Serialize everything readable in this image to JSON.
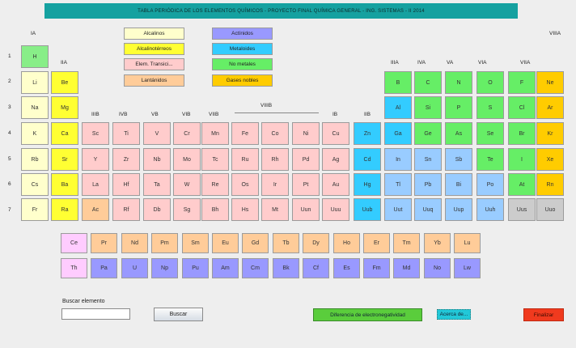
{
  "title": "TABLA PERIÓDICA DE LOS ELEMENTOS QUÍMICOS - PROYECTO FINAL QUÍMICA GENERAL - ING. SISTEMAS - II 2014",
  "colors": {
    "alcalinos": "#ffffcc",
    "alcalinoterreos": "#ffff33",
    "transicion": "#ffcccc",
    "lantanidos": "#ffcc99",
    "actinidos": "#9999ff",
    "metaloides": "#33ccff",
    "no_metales": "#66ee66",
    "gases_nobles": "#ffcc00",
    "hidrogeno": "#88ee88",
    "metales": "#99ccff",
    "desconocido": "#cccccc",
    "lantano_row": "#ffccff"
  },
  "legend": [
    {
      "label": "Alcalinos",
      "cat": "alcalinos"
    },
    {
      "label": "Alcalinotérreos",
      "cat": "alcalinoterreos"
    },
    {
      "label": "Elem. Transici...",
      "cat": "transicion"
    },
    {
      "label": "Lantánidos",
      "cat": "lantanidos"
    },
    {
      "label": "Actínidos",
      "cat": "actinidos"
    },
    {
      "label": "Metaloides",
      "cat": "metaloides"
    },
    {
      "label": "No metales",
      "cat": "no_metales"
    },
    {
      "label": "Gases nobles",
      "cat": "gases_nobles"
    }
  ],
  "group_labels": [
    "IA",
    "IIA",
    "IIIB",
    "IVB",
    "VB",
    "VIB",
    "VIIB",
    "VIIIB",
    "IB",
    "IIB",
    "IIIA",
    "IVA",
    "VA",
    "VIA",
    "VIIA",
    "VIIIA"
  ],
  "period_labels": [
    "1",
    "2",
    "3",
    "4",
    "5",
    "6",
    "7"
  ],
  "periods": [
    [
      [
        "H",
        "hidrogeno",
        1
      ]
    ],
    [
      [
        "Li",
        "alcalinos",
        1
      ],
      [
        "Be",
        "alcalinoterreos",
        2
      ],
      [
        "B",
        "no_metales",
        13
      ],
      [
        "C",
        "no_metales",
        14
      ],
      [
        "N",
        "no_metales",
        15
      ],
      [
        "O",
        "no_metales",
        16
      ],
      [
        "F",
        "no_metales",
        17
      ],
      [
        "Ne",
        "gases_nobles",
        18
      ]
    ],
    [
      [
        "Na",
        "alcalinos",
        1
      ],
      [
        "Mg",
        "alcalinoterreos",
        2
      ],
      [
        "Al",
        "metaloides",
        13
      ],
      [
        "Si",
        "no_metales",
        14
      ],
      [
        "P",
        "no_metales",
        15
      ],
      [
        "S",
        "no_metales",
        16
      ],
      [
        "Cl",
        "no_metales",
        17
      ],
      [
        "Ar",
        "gases_nobles",
        18
      ]
    ],
    [
      [
        "K",
        "alcalinos",
        1
      ],
      [
        "Ca",
        "alcalinoterreos",
        2
      ],
      [
        "Sc",
        "transicion",
        3
      ],
      [
        "Ti",
        "transicion",
        4
      ],
      [
        "V",
        "transicion",
        5
      ],
      [
        "Cr",
        "transicion",
        6
      ],
      [
        "Mn",
        "transicion",
        7
      ],
      [
        "Fe",
        "transicion",
        8
      ],
      [
        "Co",
        "transicion",
        9
      ],
      [
        "Ni",
        "transicion",
        10
      ],
      [
        "Cu",
        "transicion",
        11
      ],
      [
        "Zn",
        "metaloides",
        12
      ],
      [
        "Ga",
        "metaloides",
        13
      ],
      [
        "Ge",
        "no_metales",
        14
      ],
      [
        "As",
        "no_metales",
        15
      ],
      [
        "Se",
        "no_metales",
        16
      ],
      [
        "Br",
        "no_metales",
        17
      ],
      [
        "Kr",
        "gases_nobles",
        18
      ]
    ],
    [
      [
        "Rb",
        "alcalinos",
        1
      ],
      [
        "Sr",
        "alcalinoterreos",
        2
      ],
      [
        "Y",
        "transicion",
        3
      ],
      [
        "Zr",
        "transicion",
        4
      ],
      [
        "Nb",
        "transicion",
        5
      ],
      [
        "Mo",
        "transicion",
        6
      ],
      [
        "Tc",
        "transicion",
        7
      ],
      [
        "Ru",
        "transicion",
        8
      ],
      [
        "Rh",
        "transicion",
        9
      ],
      [
        "Pd",
        "transicion",
        10
      ],
      [
        "Ag",
        "transicion",
        11
      ],
      [
        "Cd",
        "metaloides",
        12
      ],
      [
        "In",
        "metales",
        13
      ],
      [
        "Sn",
        "metales",
        14
      ],
      [
        "Sb",
        "metales",
        15
      ],
      [
        "Te",
        "no_metales",
        16
      ],
      [
        "I",
        "no_metales",
        17
      ],
      [
        "Xe",
        "gases_nobles",
        18
      ]
    ],
    [
      [
        "Cs",
        "alcalinos",
        1
      ],
      [
        "Ba",
        "alcalinoterreos",
        2
      ],
      [
        "La",
        "transicion",
        3
      ],
      [
        "Hf",
        "transicion",
        4
      ],
      [
        "Ta",
        "transicion",
        5
      ],
      [
        "W",
        "transicion",
        6
      ],
      [
        "Re",
        "transicion",
        7
      ],
      [
        "Os",
        "transicion",
        8
      ],
      [
        "Ir",
        "transicion",
        9
      ],
      [
        "Pt",
        "transicion",
        10
      ],
      [
        "Au",
        "transicion",
        11
      ],
      [
        "Hg",
        "metaloides",
        12
      ],
      [
        "Tl",
        "metales",
        13
      ],
      [
        "Pb",
        "metales",
        14
      ],
      [
        "Bi",
        "metales",
        15
      ],
      [
        "Po",
        "metales",
        16
      ],
      [
        "At",
        "no_metales",
        17
      ],
      [
        "Rn",
        "gases_nobles",
        18
      ]
    ],
    [
      [
        "Fr",
        "alcalinos",
        1
      ],
      [
        "Ra",
        "alcalinoterreos",
        2
      ],
      [
        "Ac",
        "lantanidos",
        3
      ],
      [
        "Rf",
        "transicion",
        4
      ],
      [
        "Db",
        "transicion",
        5
      ],
      [
        "Sg",
        "transicion",
        6
      ],
      [
        "Bh",
        "transicion",
        7
      ],
      [
        "Hs",
        "transicion",
        8
      ],
      [
        "Mt",
        "transicion",
        9
      ],
      [
        "Uun",
        "transicion",
        10
      ],
      [
        "Uuu",
        "transicion",
        11
      ],
      [
        "Uub",
        "metaloides",
        12
      ],
      [
        "Uut",
        "metales",
        13
      ],
      [
        "Uuq",
        "metales",
        14
      ],
      [
        "Uup",
        "metales",
        15
      ],
      [
        "Uuh",
        "metales",
        16
      ],
      [
        "Uus",
        "desconocido",
        17
      ],
      [
        "Uuo",
        "desconocido",
        18
      ]
    ]
  ],
  "lanthanides": [
    [
      "Ce",
      "lantano_row"
    ],
    [
      "Pr",
      "lantanidos"
    ],
    [
      "Nd",
      "lantanidos"
    ],
    [
      "Pm",
      "lantanidos"
    ],
    [
      "Sm",
      "lantanidos"
    ],
    [
      "Eu",
      "lantanidos"
    ],
    [
      "Gd",
      "lantanidos"
    ],
    [
      "Tb",
      "lantanidos"
    ],
    [
      "Dy",
      "lantanidos"
    ],
    [
      "Ho",
      "lantanidos"
    ],
    [
      "Er",
      "lantanidos"
    ],
    [
      "Tm",
      "lantanidos"
    ],
    [
      "Yb",
      "lantanidos"
    ],
    [
      "Lu",
      "lantanidos"
    ]
  ],
  "actinides": [
    [
      "Th",
      "lantano_row"
    ],
    [
      "Pa",
      "actinidos"
    ],
    [
      "U",
      "actinidos"
    ],
    [
      "Np",
      "actinidos"
    ],
    [
      "Pu",
      "actinidos"
    ],
    [
      "Am",
      "actinidos"
    ],
    [
      "Cm",
      "actinidos"
    ],
    [
      "Bk",
      "actinidos"
    ],
    [
      "Cf",
      "actinidos"
    ],
    [
      "Es",
      "actinidos"
    ],
    [
      "Fm",
      "actinidos"
    ],
    [
      "Md",
      "actinidos"
    ],
    [
      "No",
      "actinidos"
    ],
    [
      "Lw",
      "actinidos"
    ]
  ],
  "search": {
    "label": "Buscar elemento",
    "value": "",
    "button": "Buscar"
  },
  "buttons": {
    "electroneg": "Diferencia de electronegatividad",
    "about": "Acerca de...",
    "finish": "Finalizar"
  }
}
